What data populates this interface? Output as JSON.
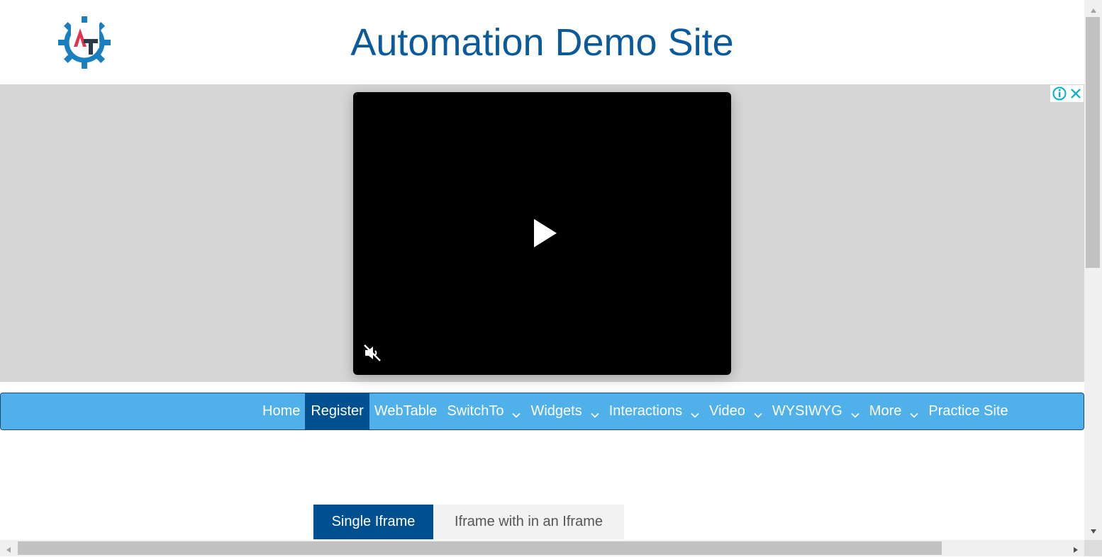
{
  "header": {
    "title": "Automation Demo Site",
    "logo_icon": "gear-logo-icon",
    "logo_letters": "AT"
  },
  "ad": {
    "info_icon": "info-icon",
    "close_icon": "close-icon",
    "video": {
      "play_icon": "play-icon",
      "mute_icon": "muted-speaker-icon"
    }
  },
  "nav": {
    "items": [
      {
        "label": "Home",
        "dropdown": false,
        "active": false
      },
      {
        "label": "Register",
        "dropdown": false,
        "active": true
      },
      {
        "label": "WebTable",
        "dropdown": false,
        "active": false
      },
      {
        "label": "SwitchTo",
        "dropdown": true,
        "active": false
      },
      {
        "label": "Widgets",
        "dropdown": true,
        "active": false
      },
      {
        "label": "Interactions",
        "dropdown": true,
        "active": false
      },
      {
        "label": "Video",
        "dropdown": true,
        "active": false
      },
      {
        "label": "WYSIWYG",
        "dropdown": true,
        "active": false
      },
      {
        "label": "More",
        "dropdown": true,
        "active": false
      },
      {
        "label": "Practice Site",
        "dropdown": false,
        "active": false
      }
    ]
  },
  "tabs": [
    {
      "label": "Single Iframe",
      "active": true
    },
    {
      "label": "Iframe with in an Iframe",
      "active": false
    }
  ],
  "colors": {
    "title": "#0a5a9c",
    "nav_bg": "#4fb0ea",
    "nav_active": "#004f8e",
    "ad_bg": "#d6d6d6",
    "logo_gear": "#1a7fc1",
    "logo_a": "#e0334f",
    "logo_t": "#2b3a4a"
  }
}
